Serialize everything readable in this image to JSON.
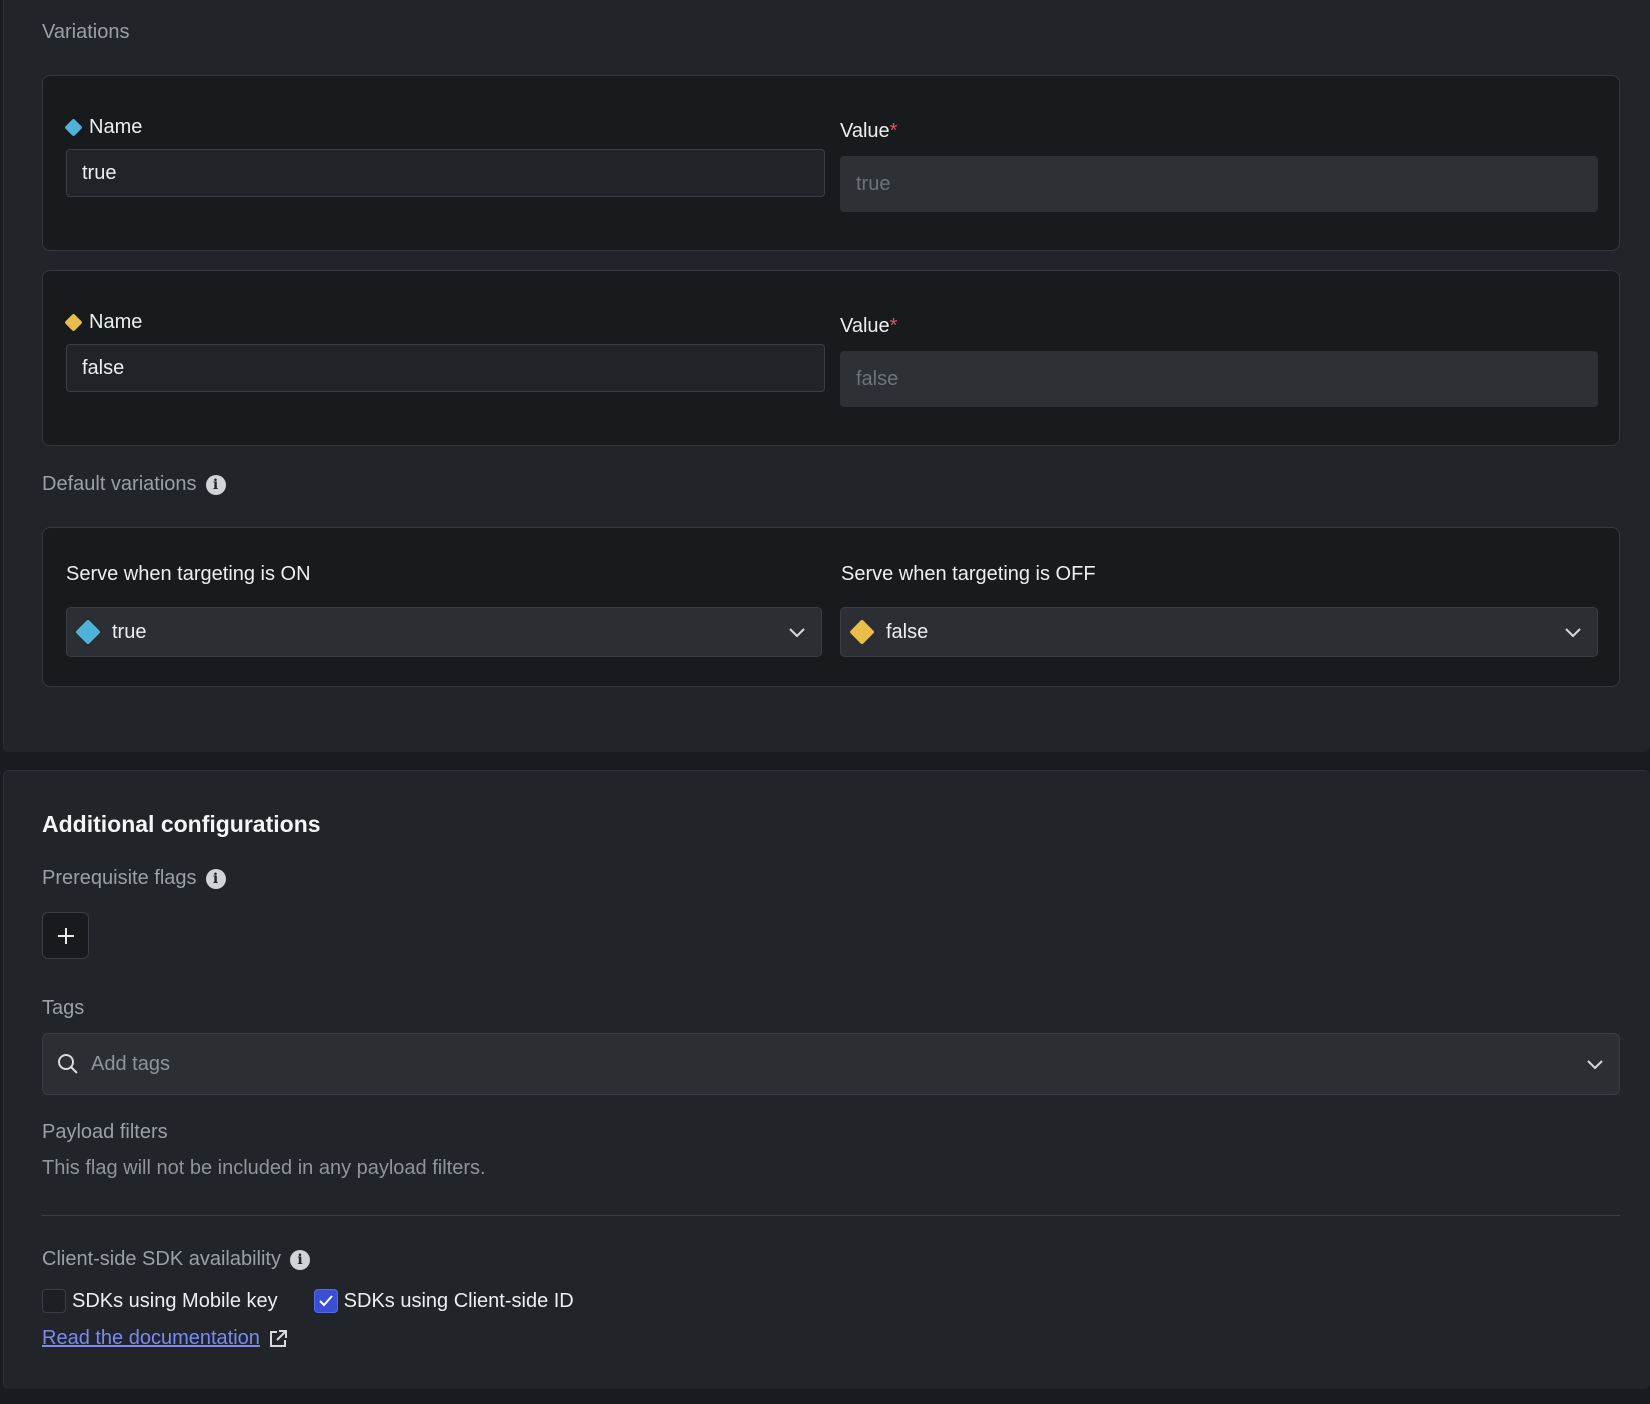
{
  "variations_section": {
    "label": "Variations",
    "items": [
      {
        "name_label": "Name",
        "name_value": "true",
        "value_label": "Value",
        "value_required": "*",
        "value_placeholder": "true",
        "color": "#4fb3d9"
      },
      {
        "name_label": "Name",
        "name_value": "false",
        "value_label": "Value",
        "value_required": "*",
        "value_placeholder": "false",
        "color": "#e8bd4a"
      }
    ]
  },
  "default_variations": {
    "label": "Default variations",
    "on": {
      "label": "Serve when targeting is ON",
      "selected": "true",
      "color": "#4fb3d9"
    },
    "off": {
      "label": "Serve when targeting is OFF",
      "selected": "false",
      "color": "#e8bd4a"
    }
  },
  "additional": {
    "title": "Additional configurations",
    "prerequisite_label": "Prerequisite flags",
    "add_prerequisite_label": "+",
    "tags_label": "Tags",
    "tags_placeholder": "Add tags",
    "payload_label": "Payload filters",
    "payload_text": "This flag will not be included in any payload filters.",
    "sdk_label": "Client-side SDK availability",
    "sdk_options": [
      {
        "label": "SDKs using Mobile key",
        "checked": false
      },
      {
        "label": "SDKs using Client-side ID",
        "checked": true
      }
    ],
    "doc_link": "Read the documentation"
  },
  "colors": {
    "accent": "#3b4fd6",
    "link": "#7e88f2",
    "required": "#e0526b",
    "true_variation": "#4fb3d9",
    "false_variation": "#e8bd4a"
  }
}
